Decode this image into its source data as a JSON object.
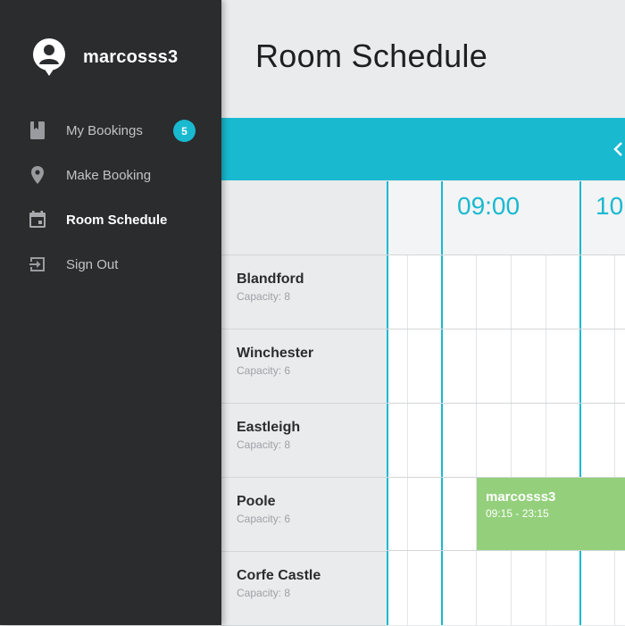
{
  "user": {
    "name": "marcosss3"
  },
  "nav": {
    "items": [
      {
        "label": "My Bookings",
        "icon": "book-icon",
        "badge": "5"
      },
      {
        "label": "Make Booking",
        "icon": "location-pin-icon"
      },
      {
        "label": "Room Schedule",
        "icon": "calendar-icon",
        "active": true
      },
      {
        "label": "Sign Out",
        "icon": "sign-out-icon"
      }
    ]
  },
  "page": {
    "title": "Room Schedule"
  },
  "toolbar": {
    "prev_icon": "chevron-left-icon"
  },
  "schedule": {
    "times": [
      "09:00",
      "10"
    ],
    "rooms": [
      {
        "name": "Blandford",
        "capacity": "Capacity: 8"
      },
      {
        "name": "Winchester",
        "capacity": "Capacity: 6"
      },
      {
        "name": "Eastleigh",
        "capacity": "Capacity: 8"
      },
      {
        "name": "Poole",
        "capacity": "Capacity: 6"
      },
      {
        "name": "Corfe Castle",
        "capacity": "Capacity: 8"
      }
    ],
    "booking": {
      "user": "marcosss3",
      "time": "09:15 - 23:15",
      "room": "Poole"
    }
  },
  "colors": {
    "accent": "#19b9d0",
    "sidebar": "#2b2c2e",
    "booking": "#94d07c"
  }
}
